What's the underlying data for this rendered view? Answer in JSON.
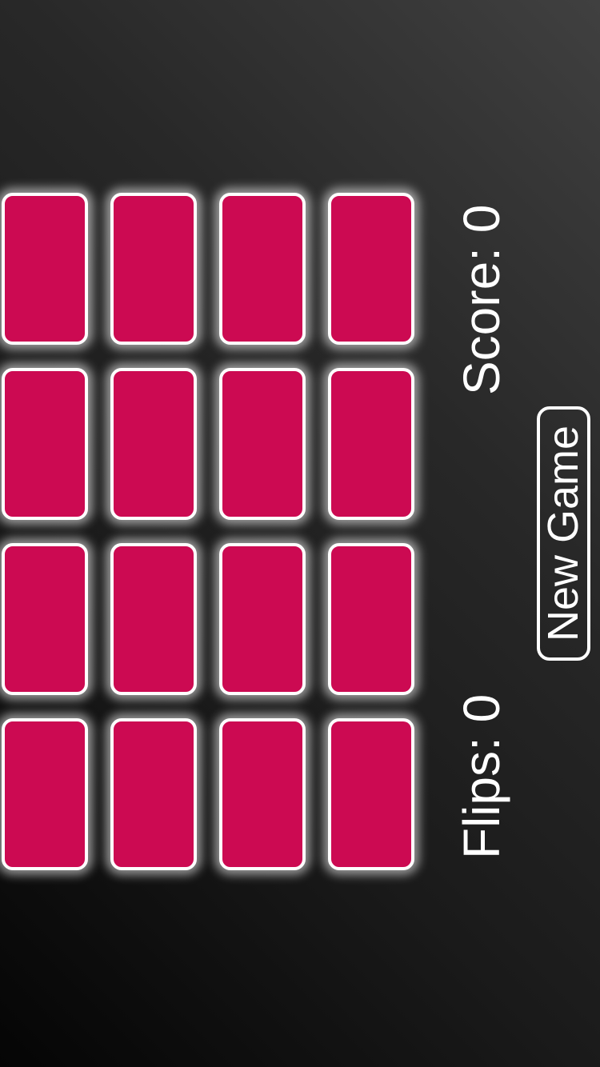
{
  "game": {
    "score_label": "Score: 0",
    "flips_label": "Flips: 0",
    "new_game_label": "New Game",
    "cards": {
      "count": 16,
      "face": "down",
      "back_color": "#cc0a52",
      "border_color": "#ffffff"
    }
  }
}
